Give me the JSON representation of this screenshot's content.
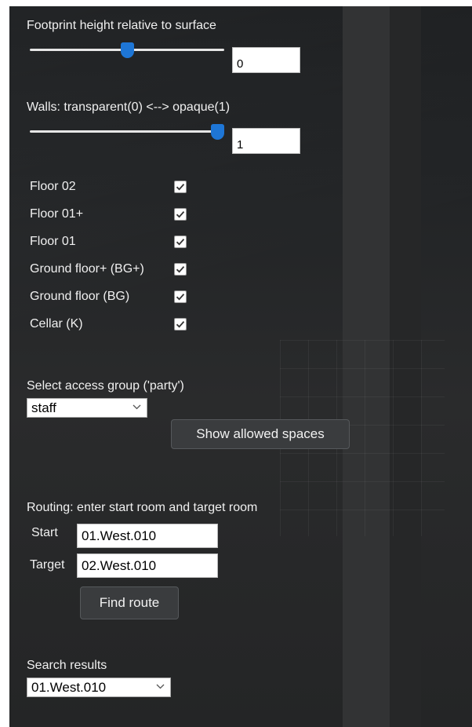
{
  "footprint": {
    "label": "Footprint height relative to surface",
    "value": "0",
    "slider_fraction": 0.5
  },
  "walls": {
    "label": "Walls: transparent(0) <--> opaque(1)",
    "value": "1",
    "slider_fraction": 1.0
  },
  "floors": [
    {
      "label": "Floor 02",
      "checked": true
    },
    {
      "label": "Floor 01+",
      "checked": true
    },
    {
      "label": "Floor 01",
      "checked": true
    },
    {
      "label": "Ground floor+ (BG+)",
      "checked": true
    },
    {
      "label": "Ground floor (BG)",
      "checked": true
    },
    {
      "label": "Cellar (K)",
      "checked": true
    }
  ],
  "access": {
    "label": "Select access group ('party')",
    "selected": "staff",
    "button_label": "Show allowed spaces"
  },
  "routing": {
    "label": "Routing: enter start room and target room",
    "start_label": "Start",
    "start_value": "01.West.010",
    "target_label": "Target",
    "target_value": "02.West.010",
    "button_label": "Find route"
  },
  "search": {
    "label": "Search results",
    "selected": "01.West.010"
  },
  "colors": {
    "accent": "#1e76d6",
    "panel_bg": "#232527",
    "text": "#f0f0f0"
  }
}
